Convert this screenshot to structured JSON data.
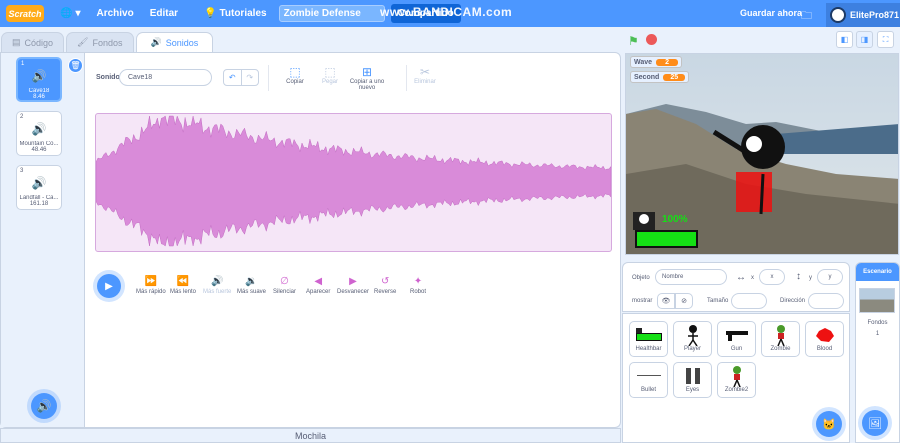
{
  "menubar": {
    "logo": "Scratch",
    "archivo": "Archivo",
    "editar": "Editar",
    "tutoriales": "Tutoriales",
    "project_title": "Zombie Defense",
    "share": "Compartido",
    "watermark": "www.BANDICAM.com",
    "save_now": "Guardar ahora",
    "username": "ElitePro871"
  },
  "tabs": {
    "code": "Código",
    "costumes": "Fondos",
    "sounds": "Sonidos"
  },
  "sounds": [
    {
      "num": "1",
      "name": "Cave18",
      "duration": "8.46"
    },
    {
      "num": "2",
      "name": "Mountain Co...",
      "duration": "48.46"
    },
    {
      "num": "3",
      "name": "Landfall - Ca...",
      "duration": "161.18"
    }
  ],
  "sound_editor": {
    "name_label": "Sonido",
    "name_value": "Cave18",
    "copy": "Copiar",
    "paste": "Pegar",
    "copy_new": "Copiar a uno nuevo",
    "delete": "Eliminar"
  },
  "effects": [
    "Más rápido",
    "Más lento",
    "Más fuerte",
    "Más suave",
    "Silenciar",
    "Aparecer",
    "Desvanecer",
    "Reverse",
    "Robot"
  ],
  "backpack": "Mochila",
  "stage": {
    "monitors": [
      {
        "label": "Wave",
        "value": "2"
      },
      {
        "label": "Second",
        "value": "25"
      }
    ],
    "health_text": "100%"
  },
  "sprite_info": {
    "object_label": "Objeto",
    "object_name": "Nombre",
    "x_label": "x",
    "x_value": "x",
    "y_label": "y",
    "y_value": "y",
    "show_label": "mostrar",
    "size_label": "Tamaño",
    "direction_label": "Dirección"
  },
  "sprites": [
    "Healthbar",
    "Player",
    "Gun",
    "Zombie",
    "Blood",
    "Bullet",
    "Eyes",
    "Zombie2"
  ],
  "stage_panel": {
    "title": "Escenario",
    "backdrops_label": "Fondos",
    "backdrops_count": "1"
  },
  "colors": {
    "accent": "#4c97ff",
    "sound": "#cf63cf",
    "orange": "#ff8c1a"
  }
}
